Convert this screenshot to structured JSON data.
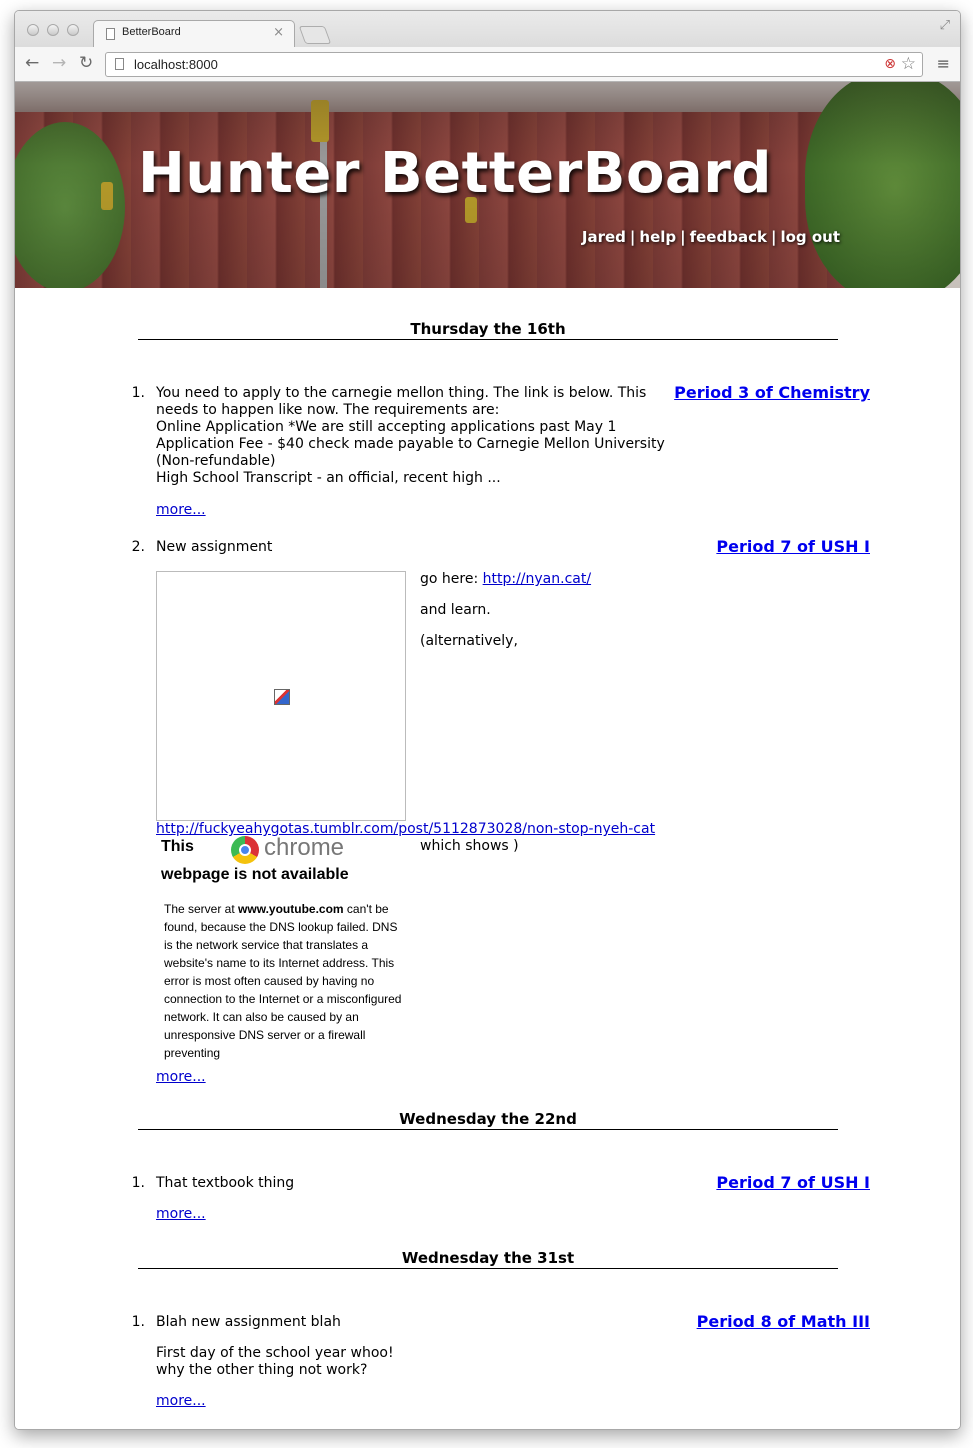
{
  "browser": {
    "tab_title": "BetterBoard",
    "url": "localhost:8000"
  },
  "site": {
    "title": "Hunter BetterBoard",
    "nav": [
      "Jared",
      "help",
      "feedback",
      "log out"
    ],
    "nav_separator": "|"
  },
  "days": [
    {
      "heading": "Thursday the 16th",
      "items": [
        {
          "number": "1.",
          "lines": [
            "You need to apply to the carnegie mellon thing. The link is below. This",
            "needs to happen like now. The requirements are:",
            "Online Application *We are still accepting applications past May 1",
            "Application Fee - $40 check made payable to Carnegie Mellon University",
            "(Non-refundable)",
            "High School Transcript - an official, recent high ..."
          ],
          "course": "Period 3 of Chemistry",
          "more": "more..."
        },
        {
          "number": "2.",
          "title": "New assignment",
          "course": "Period 7 of USH I",
          "side_lines": {
            "go_here": "go here: ",
            "nyan_link": "http://nyan.cat/",
            "and_learn": "and learn.",
            "alternatively": "(alternatively,",
            "which_shows": "which shows )"
          },
          "long_link": "http://fuckyeahygotas.tumblr.com/post/5112873028/non-stop-nyeh-cat",
          "embed_error": {
            "this": "This",
            "chrome_word": "chrome",
            "heading": "webpage is not available",
            "msg_pre": "The server at ",
            "msg_host": "www.youtube.com",
            "msg_post": " can't be found, because the DNS lookup failed. DNS is the network service that translates a website's name to its Internet address. This error is most often caused by having no connection to the Internet or a misconfigured network. It can also be caused by an unresponsive DNS server or a firewall preventing"
          },
          "more": "more..."
        }
      ]
    },
    {
      "heading": "Wednesday the 22nd",
      "items": [
        {
          "number": "1.",
          "title": "That textbook thing",
          "course": "Period 7 of USH I",
          "more": "more..."
        }
      ]
    },
    {
      "heading": "Wednesday the 31st",
      "items": [
        {
          "number": "1.",
          "title": "Blah new assignment blah",
          "lines": [
            "First day of the school year whoo!",
            "why the other thing not work?"
          ],
          "course": "Period 8 of Math III",
          "more": "more..."
        }
      ]
    }
  ]
}
